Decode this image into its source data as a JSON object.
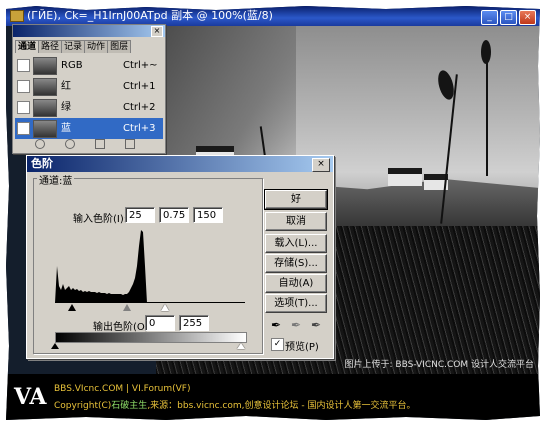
{
  "app": {
    "window_title": "(ГЙЕ), Ck=_H1IrnJ00ATpd 副本 @ 100%(蓝/8)"
  },
  "palette": {
    "tabs": [
      "通道",
      "路径",
      "记录",
      "动作",
      "图层"
    ],
    "channels": [
      {
        "name": "RGB",
        "shortcut": "Ctrl+~",
        "visible": false,
        "selected": false
      },
      {
        "name": "红",
        "shortcut": "Ctrl+1",
        "visible": false,
        "selected": false
      },
      {
        "name": "绿",
        "shortcut": "Ctrl+2",
        "visible": false,
        "selected": false
      },
      {
        "name": "蓝",
        "shortcut": "Ctrl+3",
        "visible": true,
        "selected": true
      }
    ]
  },
  "levels": {
    "title": "色阶",
    "channel_label": "通道:蓝",
    "input_label": "输入色阶(I):",
    "input_black": "25",
    "input_gamma": "0.75",
    "input_white": "150",
    "output_label": "输出色阶(O):",
    "output_black": "0",
    "output_white": "255",
    "buttons": {
      "ok": "好",
      "cancel": "取消",
      "load": "载入(L)...",
      "save": "存储(S)...",
      "auto": "自动(A)",
      "options": "选项(T)..."
    },
    "preview_label": "预览(P)",
    "preview_checked": true
  },
  "photo": {
    "watermark": "图片上传于: BBS-VICNC.COM 设计人交流平台"
  },
  "footer": {
    "logo": "VA",
    "line1": "BBS.VIcnc.COM | VI.Forum(VF)",
    "line2_prefix": "Copyright(C)",
    "line2_author": "石破主生",
    "line2_suffix": ",来源：bbs.vicnc.com,创意设计论坛 - 国内设计人第一交流平台。"
  }
}
